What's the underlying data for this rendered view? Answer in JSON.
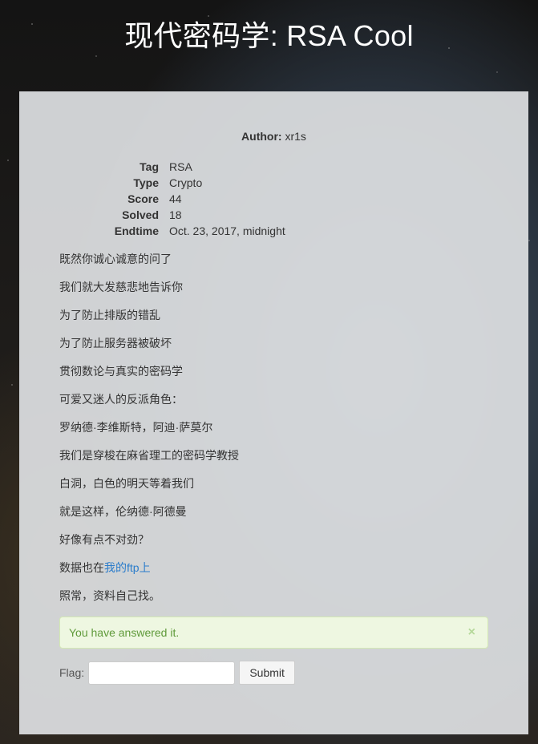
{
  "page": {
    "title": "现代密码学: RSA Cool"
  },
  "challenge": {
    "author_label": "Author:",
    "author": "xr1s",
    "meta": [
      {
        "key": "Tag",
        "value": "RSA"
      },
      {
        "key": "Type",
        "value": "Crypto"
      },
      {
        "key": "Score",
        "value": "44"
      },
      {
        "key": "Solved",
        "value": "18"
      },
      {
        "key": "Endtime",
        "value": "Oct. 23, 2017, midnight"
      }
    ],
    "description": [
      "既然你诚心诚意的问了",
      "我们就大发慈悲地告诉你",
      "为了防止排版的错乱",
      "为了防止服务器被破坏",
      "贯彻数论与真实的密码学",
      "可爱又迷人的反派角色：",
      "罗纳德·李维斯特，阿迪·萨莫尔",
      "我们是穿梭在麻省理工的密码学教授",
      "白洞，白色的明天等着我们",
      "就是这样，伦纳德·阿德曼",
      "好像有点不对劲？"
    ],
    "data_line_prefix": "数据也在",
    "data_link_text": "我的ftp上",
    "last_line": "照常，资料自己找。"
  },
  "alert": {
    "message": "You have answered it.",
    "close_symbol": "×"
  },
  "form": {
    "flag_label": "Flag:",
    "flag_value": "",
    "submit_label": "Submit"
  },
  "colors": {
    "link": "#2a7ccb",
    "alert_text": "#5f9a3a",
    "alert_bg": "#eef7e1"
  }
}
